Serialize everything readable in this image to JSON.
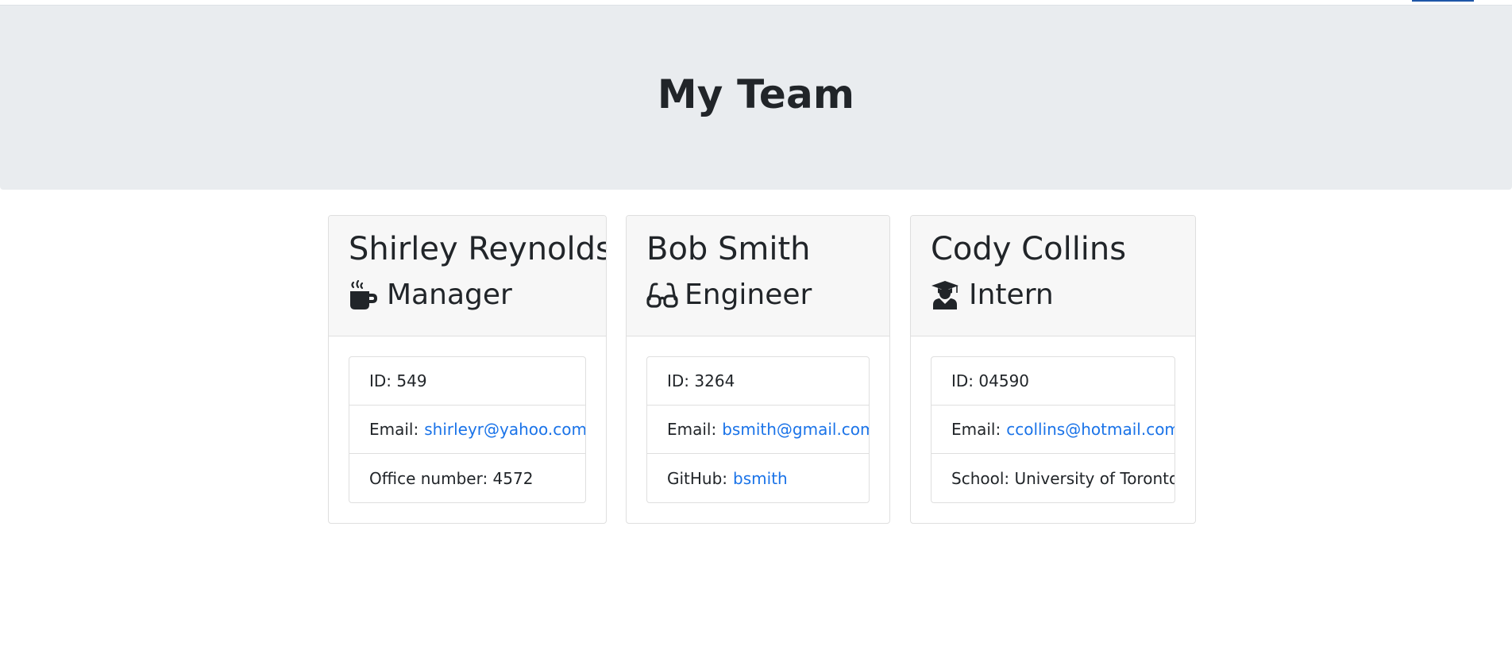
{
  "page": {
    "title": "My Team"
  },
  "colors": {
    "header_bg": "#e9ecef",
    "card_header_bg": "#f7f7f7",
    "link": "#1a73e8",
    "text": "#212529"
  },
  "team": [
    {
      "name": "Shirley Reynolds",
      "role": "Manager",
      "icon": "mug-icon",
      "id_label": "ID: 549",
      "email_label": "Email:",
      "email": "shirleyr@yahoo.com",
      "extra_label": "Office number: 4572",
      "extra_link": ""
    },
    {
      "name": "Bob Smith",
      "role": "Engineer",
      "icon": "glasses-icon",
      "id_label": "ID: 3264",
      "email_label": "Email:",
      "email": "bsmith@gmail.com",
      "extra_label": "GitHub:",
      "extra_link": "bsmith"
    },
    {
      "name": "Cody Collins",
      "role": "Intern",
      "icon": "graduate-icon",
      "id_label": "ID: 04590",
      "email_label": "Email:",
      "email": "ccollins@hotmail.com",
      "extra_label": "School: University of Toronto",
      "extra_link": ""
    }
  ]
}
